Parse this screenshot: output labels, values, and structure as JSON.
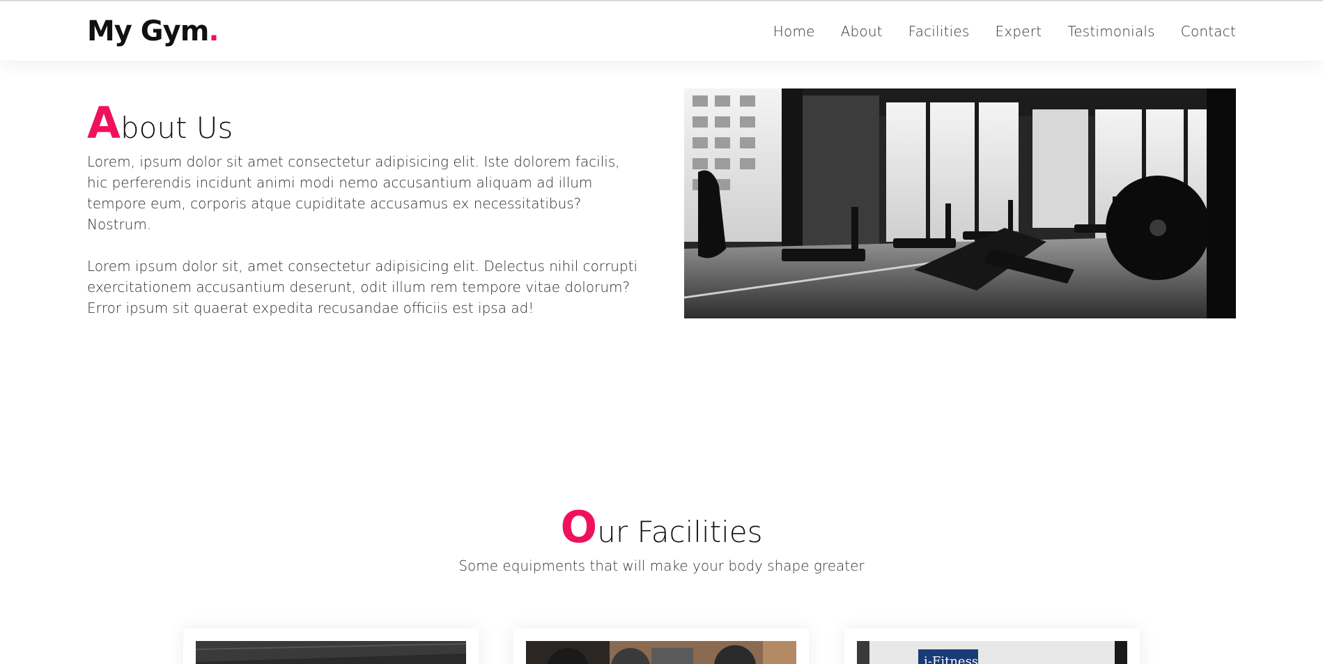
{
  "brand": {
    "name": "My Gym",
    "dot": ".",
    "accent_color": "#f0115c"
  },
  "nav": {
    "items": [
      {
        "label": "Home"
      },
      {
        "label": "About"
      },
      {
        "label": "Facilities"
      },
      {
        "label": "Expert"
      },
      {
        "label": "Testimonials"
      },
      {
        "label": "Contact"
      }
    ]
  },
  "about": {
    "title_first_letter": "A",
    "title_rest": "bout Us",
    "paragraph_1": "Lorem, ipsum dolor sit amet consectetur adipisicing elit. Iste dolorem facilis, hic perferendis incidunt animi modi nemo accusantium aliquam ad illum tempore eum, corporis atque cupiditate accusamus ex necessitatibus? Nostrum.",
    "paragraph_2": "Lorem ipsum dolor sit, amet consectetur adipisicing elit. Delectus nihil corrupti exercitationem accusantium deserunt, odit illum rem tempore vitae dolorum? Error ipsum sit quaerat expedita recusandae officiis est ipsa ad!"
  },
  "facilities": {
    "title_first_letter": "O",
    "title_rest": "ur Facilities",
    "subtitle": "Some equipments that will make your body shape greater",
    "card3_sign_text": "i-Fitness"
  }
}
